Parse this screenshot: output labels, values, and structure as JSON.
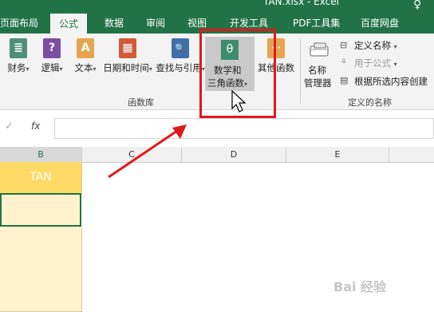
{
  "window": {
    "title": "TAN.xlsx - Excel",
    "help_glyph": "♀"
  },
  "tabs": [
    {
      "label": "页面布局",
      "active": false
    },
    {
      "label": "公式",
      "active": true
    },
    {
      "label": "数据",
      "active": false
    },
    {
      "label": "审阅",
      "active": false
    },
    {
      "label": "视图",
      "active": false
    },
    {
      "label": "开发工具",
      "active": false
    },
    {
      "label": "PDF工具集",
      "active": false
    },
    {
      "label": "百度网盘",
      "active": false
    }
  ],
  "ribbon": {
    "function_library": {
      "buttons": [
        {
          "label": "财务",
          "icon": "finance-icon",
          "glyph": "≣",
          "color": "#4f8f7a"
        },
        {
          "label": "逻辑",
          "icon": "logic-icon",
          "glyph": "?",
          "color": "#7b4ea3"
        },
        {
          "label": "文本",
          "icon": "text-icon",
          "glyph": "A",
          "color": "#e5a550"
        },
        {
          "label": "日期和时间",
          "icon": "datetime-icon",
          "glyph": "▦",
          "color": "#d05b3a"
        },
        {
          "label": "查找与引用",
          "icon": "lookup-icon",
          "glyph": "🔍",
          "color": "#3f6fa8"
        }
      ],
      "math_button": {
        "line1": "数学和",
        "line2": "三角函数",
        "icon": "theta-icon",
        "glyph": "θ"
      },
      "other_button": {
        "label": "其他函数",
        "icon": "more-functions-icon",
        "glyph": "···"
      },
      "group_label": "函数库"
    },
    "defined_names": {
      "manager_line1": "名称",
      "manager_line2": "管理器",
      "define_name": "定义名称",
      "use_in_formula": "用于公式",
      "create_from_selection": "根据所选内容创建",
      "group_label": "定义的名称"
    }
  },
  "formula_bar": {
    "check_glyph": "✓",
    "fx_label": "fx",
    "value": ""
  },
  "columns": [
    "B",
    "C",
    "D",
    "E"
  ],
  "cells": {
    "B1": "TAN"
  },
  "watermark": "Bai 经验"
}
